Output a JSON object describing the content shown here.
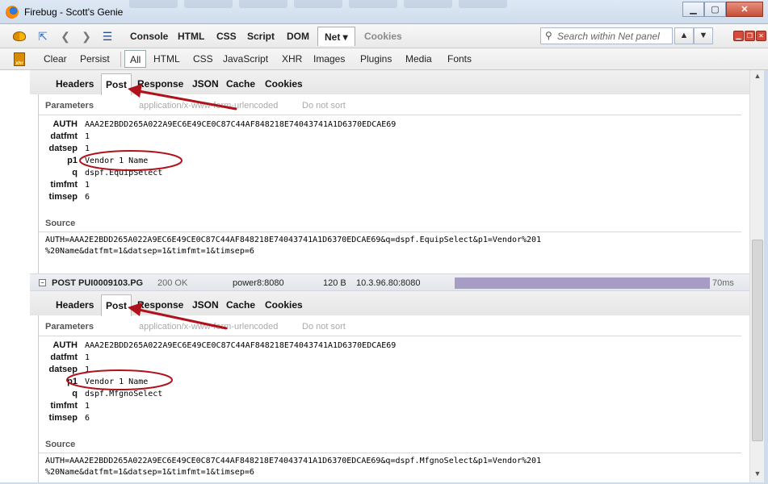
{
  "window": {
    "title": "Firebug - Scott's Genie"
  },
  "toolbar": {
    "tabs": [
      "Console",
      "HTML",
      "CSS",
      "Script",
      "DOM",
      "Net",
      "Cookies"
    ],
    "active_tab": "Net",
    "net_menu_label": "Net ▾",
    "search_placeholder": "Search within Net panel"
  },
  "filters": {
    "clear": "Clear",
    "persist": "Persist",
    "items": [
      "All",
      "HTML",
      "CSS",
      "JavaScript",
      "XHR",
      "Images",
      "Plugins",
      "Media",
      "Fonts"
    ],
    "active": "All"
  },
  "detail_tabs": [
    "Headers",
    "Post",
    "Response",
    "JSON",
    "Cache",
    "Cookies"
  ],
  "active_detail_tab": "Post",
  "panels": [
    {
      "params_title": "Parameters",
      "params_type": "application/x-www-form-urlencoded",
      "params_sort": "Do not sort",
      "params": [
        {
          "name": "AUTH",
          "value": "AAA2E2BDD265A022A9EC6E49CE0C87C44AF848218E74043741A1D6370EDCAE69"
        },
        {
          "name": "datfmt",
          "value": "1"
        },
        {
          "name": "datsep",
          "value": "1"
        },
        {
          "name": "p1",
          "value": "Vendor 1 Name"
        },
        {
          "name": "q",
          "value": "dspf.EquipSelect"
        },
        {
          "name": "timfmt",
          "value": "1"
        },
        {
          "name": "timsep",
          "value": "6"
        }
      ],
      "source_title": "Source",
      "source_lines": [
        "AUTH=AAA2E2BDD265A022A9EC6E49CE0C87C44AF848218E74043741A1D6370EDCAE69&q=dspf.EquipSelect&p1=Vendor%201",
        "%20Name&datfmt=1&datsep=1&timfmt=1&timsep=6"
      ]
    },
    {
      "params_title": "Parameters",
      "params_type": "application/x-www-form-urlencoded",
      "params_sort": "Do not sort",
      "params": [
        {
          "name": "AUTH",
          "value": "AAA2E2BDD265A022A9EC6E49CE0C87C44AF848218E74043741A1D6370EDCAE69"
        },
        {
          "name": "datfmt",
          "value": "1"
        },
        {
          "name": "datsep",
          "value": "1"
        },
        {
          "name": "p1",
          "value": "Vendor 1 Name"
        },
        {
          "name": "q",
          "value": "dspf.MfgnoSelect"
        },
        {
          "name": "timfmt",
          "value": "1"
        },
        {
          "name": "timsep",
          "value": "6"
        }
      ],
      "source_title": "Source",
      "source_lines": [
        "AUTH=AAA2E2BDD265A022A9EC6E49CE0C87C44AF848218E74043741A1D6370EDCAE69&q=dspf.MfgnoSelect&p1=Vendor%201",
        "%20Name&datfmt=1&datsep=1&timfmt=1&timsep=6"
      ]
    }
  ],
  "request_row": {
    "toggle": "−",
    "url": "POST PUI0009103.PG",
    "status": "200 OK",
    "domain": "power8:8080",
    "size": "120 B",
    "remote_ip": "10.3.96.80:8080",
    "time": "70ms"
  },
  "colors": {
    "annotation_red": "#b0121b",
    "timeline_bar": "#a79cc3"
  }
}
